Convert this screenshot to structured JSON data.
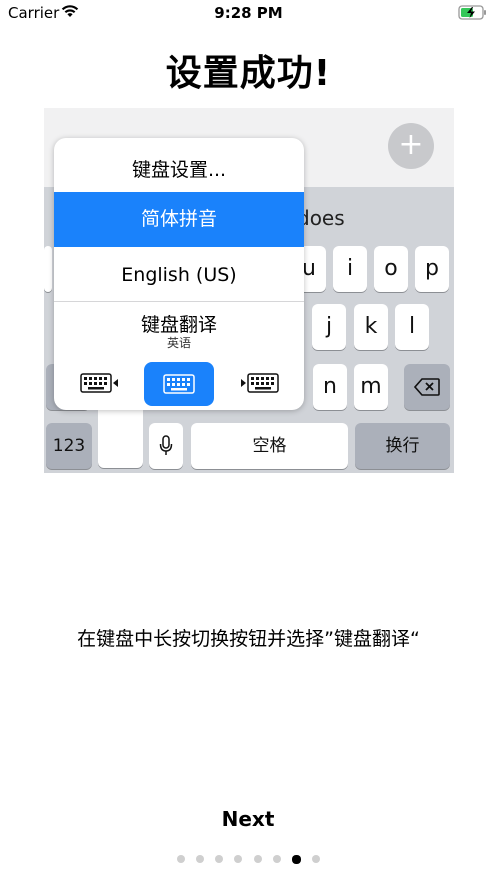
{
  "status_bar": {
    "carrier": "Carrier",
    "time": "9:28 PM",
    "wifi_icon": "wifi-icon",
    "battery_icon": "battery-charging-icon"
  },
  "title": "设置成功!",
  "illustration": {
    "plus_label": "+",
    "suggestion_text": "does",
    "popup": {
      "items": [
        "键盘设置...",
        "简体拼音",
        "English (US)",
        "键盘翻译"
      ],
      "selected_index": 1,
      "sub_label": "英语",
      "accent": "#1a82fb",
      "icons": [
        "keyboard-left-icon",
        "keyboard-icon",
        "keyboard-right-icon"
      ]
    },
    "keys": {
      "row1": [
        "u",
        "i",
        "o",
        "p"
      ],
      "row2": [
        "j",
        "k",
        "l"
      ],
      "row3": [
        "n",
        "m"
      ],
      "numbers": "123",
      "space": "空格",
      "return": "换行",
      "mic_icon": "microphone-icon",
      "delete_icon": "backspace-icon"
    }
  },
  "instruction": "在键盘中长按切换按钮并选择”键盘翻译“",
  "next_label": "Next",
  "pagination": {
    "count": 8,
    "active_index": 6
  }
}
